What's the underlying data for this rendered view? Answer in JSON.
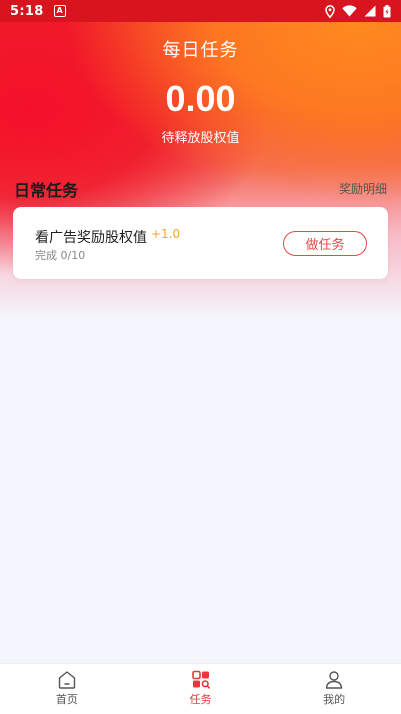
{
  "status_bar": {
    "time": "5:18",
    "notification_glyph": "A",
    "icons": [
      "location-icon",
      "wifi-icon",
      "signal-icon",
      "battery-icon"
    ]
  },
  "header": {
    "title": "每日任务",
    "amount": "0.00",
    "amount_label": "待释放股权值"
  },
  "daily_tasks": {
    "section_title": "日常任务",
    "details_link": "奖励明细",
    "tasks": [
      {
        "name": "看广告奖励股权值",
        "bonus": "+1.0",
        "progress": "完成 0/10",
        "action_label": "做任务"
      }
    ]
  },
  "bottom_nav": {
    "items": [
      {
        "label": "首页",
        "icon": "home-icon",
        "active": false
      },
      {
        "label": "任务",
        "icon": "tasks-icon",
        "active": true
      },
      {
        "label": "我的",
        "icon": "profile-icon",
        "active": false
      }
    ]
  },
  "colors": {
    "accent": "#e8373b",
    "bonus": "#f0a52a",
    "status_bar": "#d8141f",
    "page_background": "#f4f6fd"
  }
}
